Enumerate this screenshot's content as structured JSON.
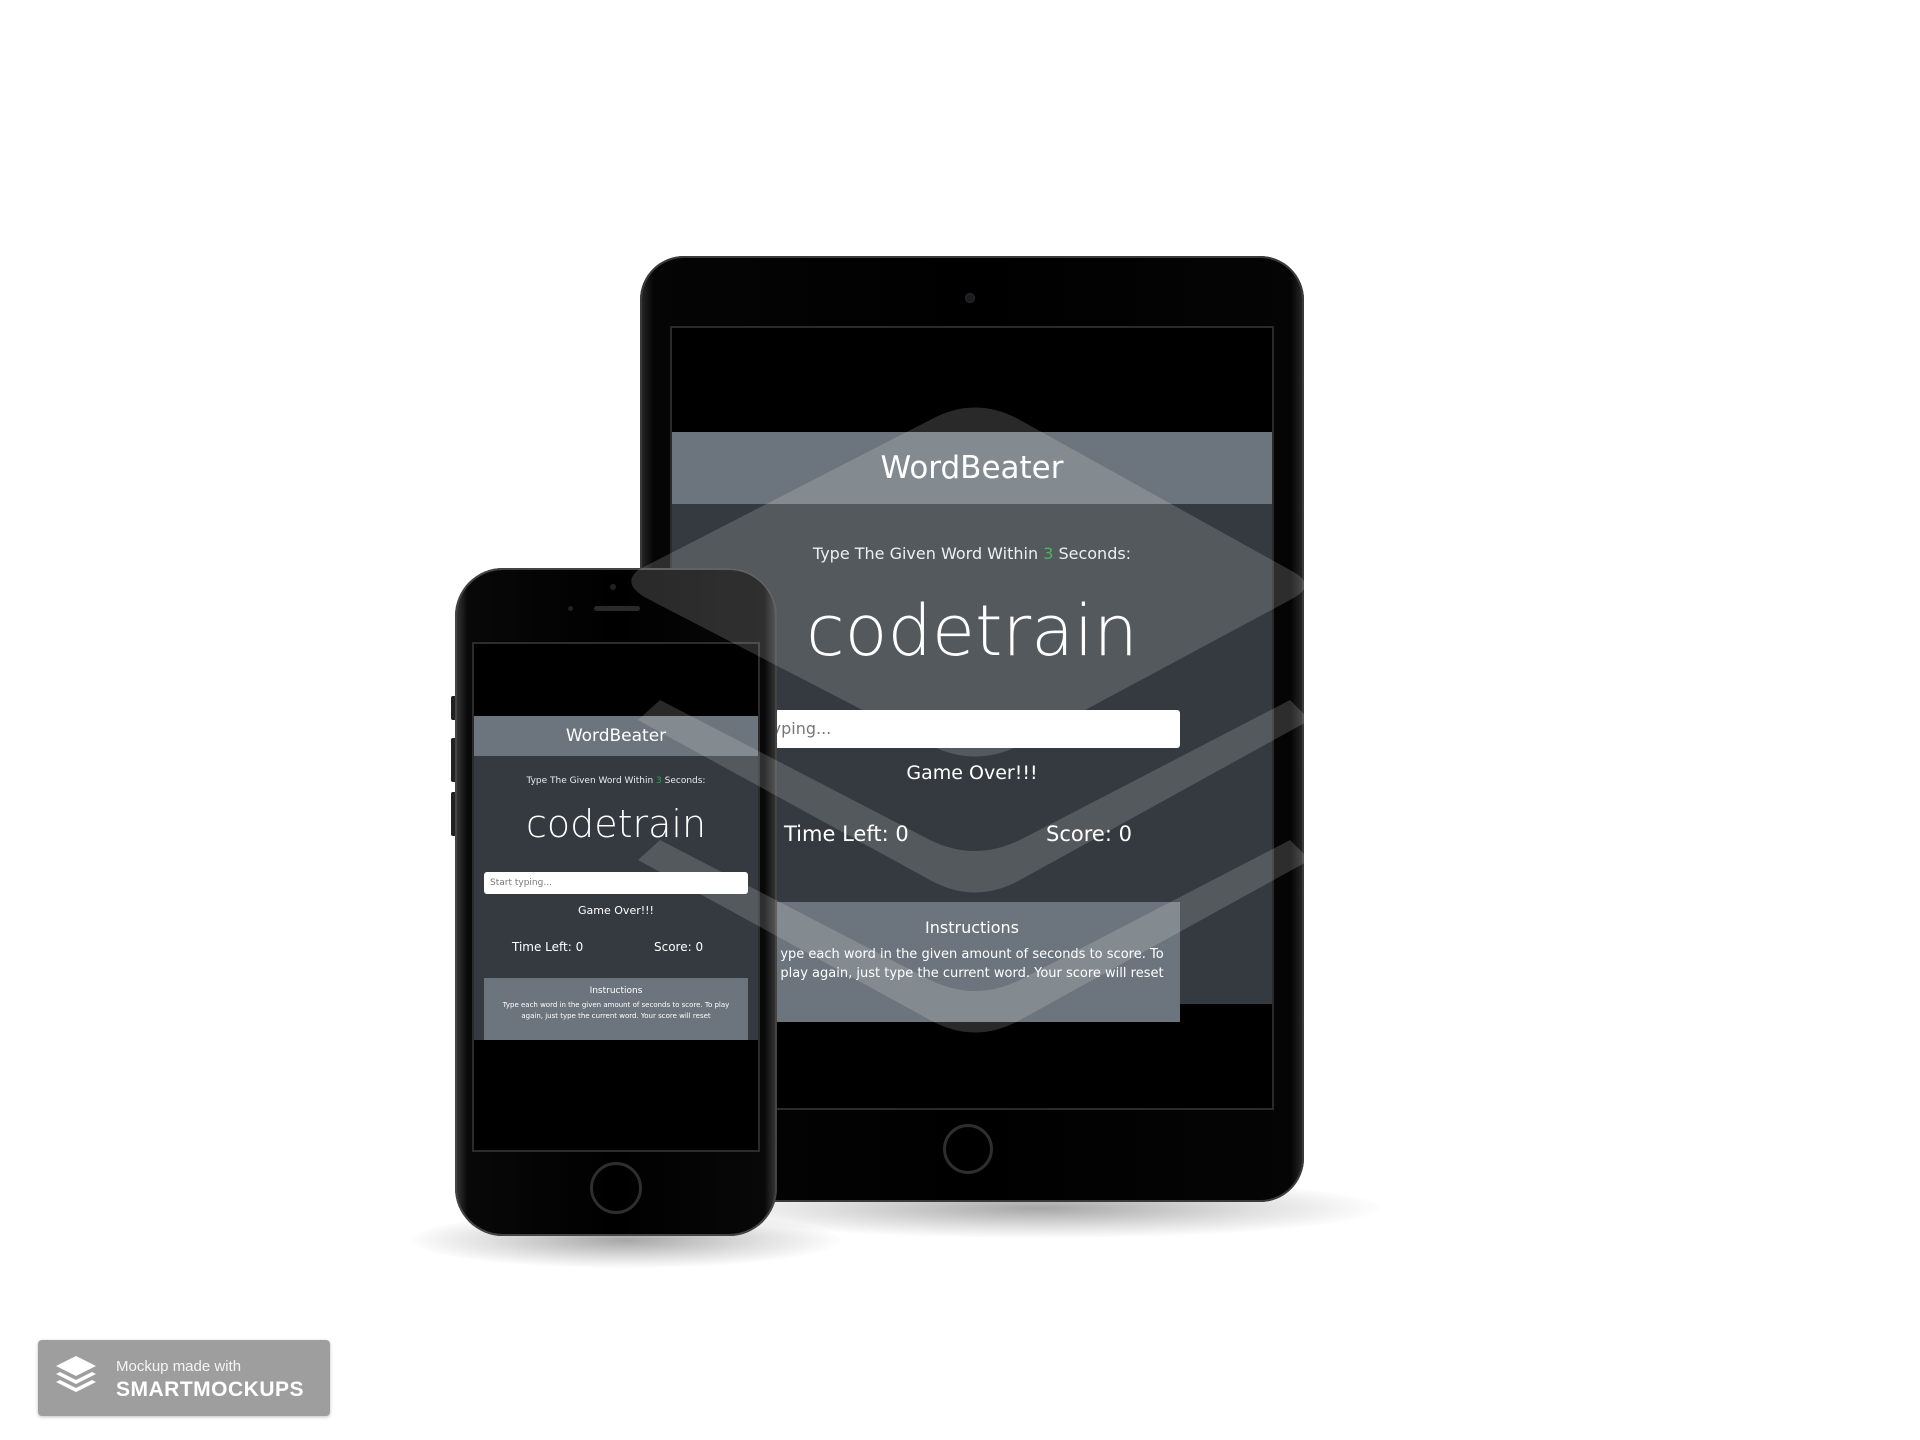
{
  "app": {
    "title": "WordBeater",
    "instruction_prefix": "Type The Given Word Within ",
    "seconds": "3",
    "instruction_suffix": " Seconds:",
    "current_word": "codetrain",
    "input_placeholder": "Start typing...",
    "tablet_input_visible_text": "t typing...",
    "message": "Game Over!!!",
    "time_left_label": "Time Left: ",
    "time_left_value": "0",
    "score_label": "Score: ",
    "score_value": "0",
    "instructions_title": "Instructions",
    "instructions_text": "Type each word in the given amount of seconds to score. To play again, just type the current word. Your score will reset",
    "tablet_instructions_visible_text": "ype each word in the given amount of seconds to score. To play again, just type the current word. Your score will reset"
  },
  "badge": {
    "line1": "Mockup made with",
    "line2": "SMARTMOCKUPS"
  },
  "colors": {
    "navbar": "#6c757d",
    "content": "#343a40",
    "seconds_accent": "#28a745",
    "background": "#ffffff",
    "badge": "#9e9e9e"
  },
  "icons": [
    "layers-logo-icon",
    "watermark-layers-icon"
  ]
}
